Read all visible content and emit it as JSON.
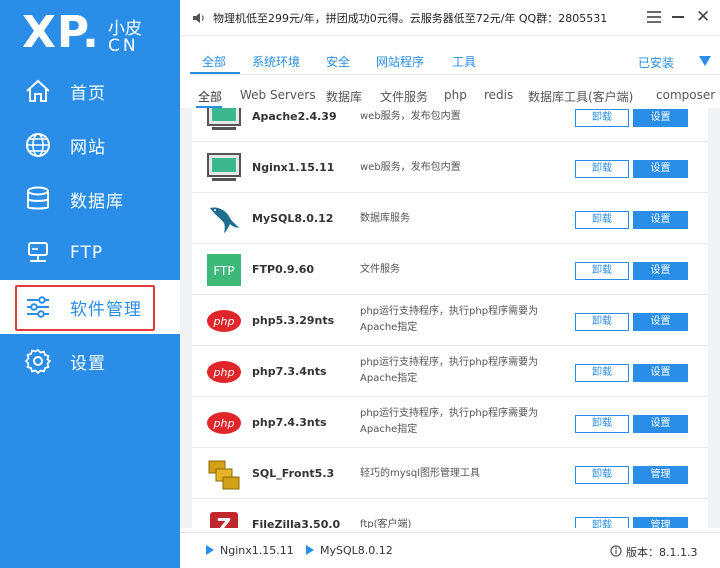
{
  "logo": {
    "main": "XP.",
    "small": "小皮",
    "cn": "CN"
  },
  "sidebar": {
    "items": [
      {
        "label": "首页",
        "icon": "home-icon"
      },
      {
        "label": "网站",
        "icon": "globe-icon"
      },
      {
        "label": "数据库",
        "icon": "database-icon"
      },
      {
        "label": "FTP",
        "icon": "server-icon"
      },
      {
        "label": "软件管理",
        "icon": "sliders-icon",
        "active": true
      },
      {
        "label": "设置",
        "icon": "gear-icon"
      }
    ]
  },
  "notice": {
    "text": "物理机低至299元/年，拼团成功0元得。云服务器低至72元/年   QQ群：2805531",
    "close": "✕"
  },
  "category_tabs": {
    "items": [
      "全部",
      "系统环境",
      "安全",
      "网站程序",
      "工具"
    ],
    "active": "全部",
    "installed": "已安装"
  },
  "sub_tabs": {
    "items": [
      "全部",
      "Web Servers",
      "数据库",
      "文件服务",
      "php",
      "redis",
      "数据库工具(客户端)",
      "composer"
    ],
    "active": "全部"
  },
  "software": [
    {
      "name": "Apache2.4.39",
      "desc": "web服务，发布包内置",
      "btn1": "卸载",
      "btn2": "设置",
      "icon": "apache-monitor-icon"
    },
    {
      "name": "Nginx1.15.11",
      "desc": "web服务，发布包内置",
      "btn1": "卸载",
      "btn2": "设置",
      "icon": "nginx-monitor-icon"
    },
    {
      "name": "MySQL8.0.12",
      "desc": "数据库服务",
      "btn1": "卸载",
      "btn2": "设置",
      "icon": "mysql-dolphin-icon"
    },
    {
      "name": "FTP0.9.60",
      "desc": "文件服务",
      "btn1": "卸载",
      "btn2": "设置",
      "icon": "ftp-icon"
    },
    {
      "name": "php5.3.29nts",
      "desc": "php运行支持程序，执行php程序需要为Apache指定",
      "btn1": "卸载",
      "btn2": "设置",
      "icon": "php-icon"
    },
    {
      "name": "php7.3.4nts",
      "desc": "php运行支持程序，执行php程序需要为Apache指定",
      "btn1": "卸载",
      "btn2": "设置",
      "icon": "php-icon"
    },
    {
      "name": "php7.4.3nts",
      "desc": "php运行支持程序，执行php程序需要为Apache指定",
      "btn1": "卸载",
      "btn2": "设置",
      "icon": "php-icon"
    },
    {
      "name": "SQL_Front5.3",
      "desc": "轻巧的mysql图形管理工具",
      "btn1": "卸载",
      "btn2": "管理",
      "icon": "sqlfront-icon"
    },
    {
      "name": "FileZilla3.50.0",
      "desc": "ftp(客户端)",
      "btn1": "卸载",
      "btn2": "管理",
      "icon": "filezilla-icon"
    }
  ],
  "status_bar": {
    "items": [
      "Nginx1.15.11",
      "MySQL8.0.12"
    ],
    "version": "版本：8.1.1.3"
  },
  "colors": {
    "accent": "#2a8ee8",
    "highlight": "#e23b3b",
    "ftp_green": "#3cb878",
    "php_red": "#e0262b"
  }
}
